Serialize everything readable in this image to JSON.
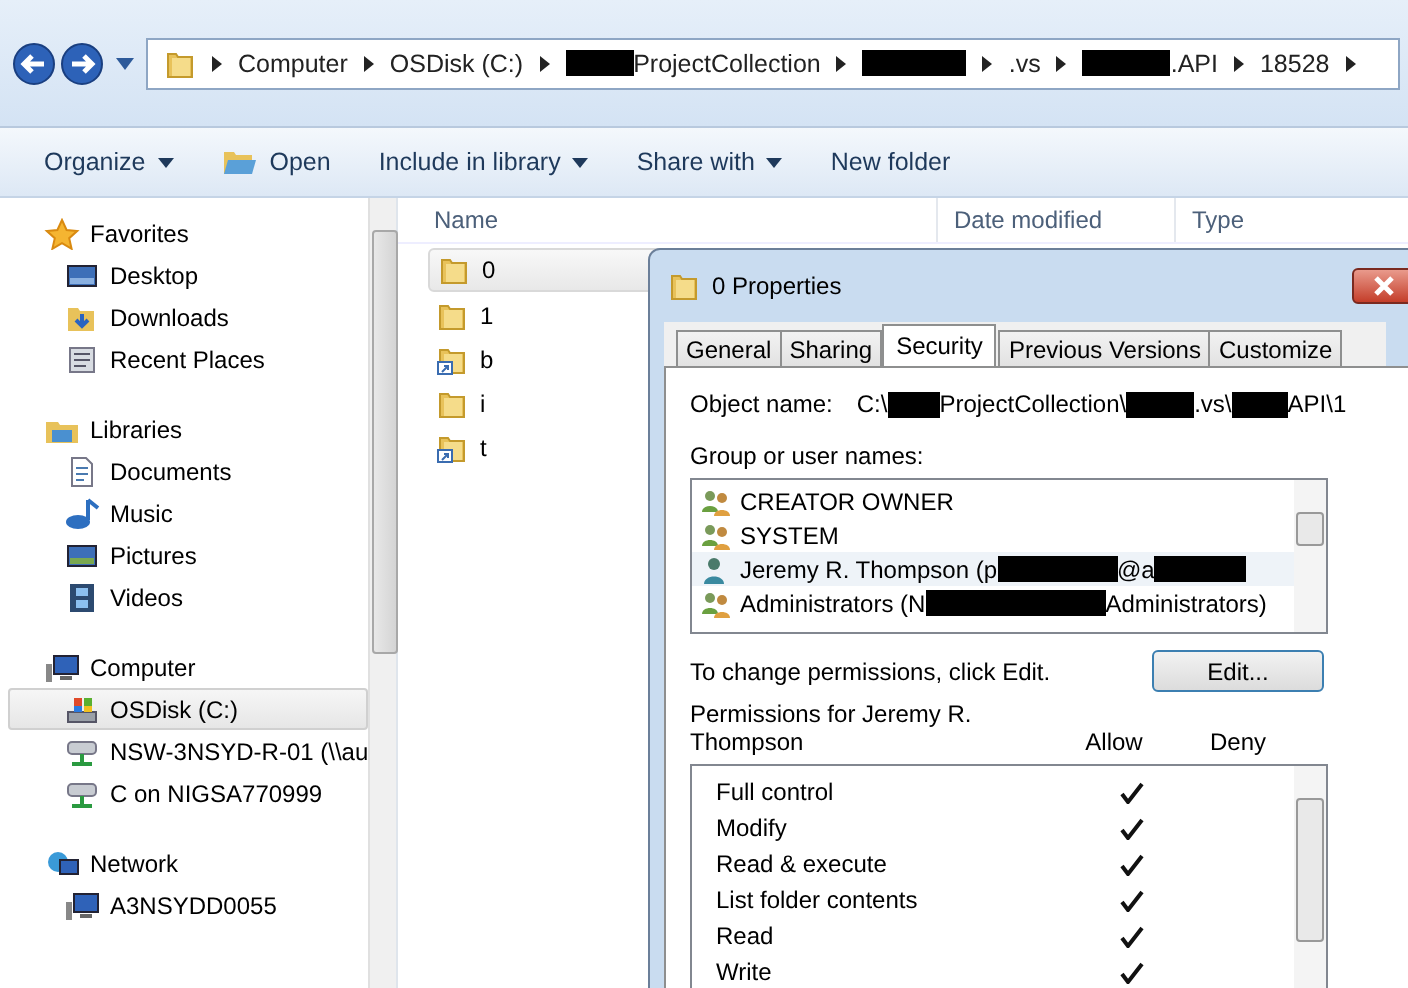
{
  "address_bar": {
    "crumbs": [
      {
        "parts": [
          {
            "text": "Computer"
          }
        ]
      },
      {
        "parts": [
          {
            "text": "OSDisk (C:)"
          }
        ]
      },
      {
        "parts": [
          {
            "kind": "redaction"
          },
          {
            "text": "ProjectCollection"
          }
        ]
      },
      {
        "parts": [
          {
            "kind": "redaction"
          }
        ]
      },
      {
        "parts": [
          {
            "text": ".vs"
          }
        ]
      },
      {
        "parts": [
          {
            "kind": "redaction"
          },
          {
            "text": ".API"
          }
        ]
      },
      {
        "parts": [
          {
            "text": "18528"
          }
        ]
      }
    ]
  },
  "toolbar": [
    {
      "label": "Organize",
      "dropdown": true,
      "kind": "plain"
    },
    {
      "label": "Open",
      "dropdown": false,
      "kind": "open"
    },
    {
      "label": "Include in library",
      "dropdown": true,
      "kind": "plain"
    },
    {
      "label": "Share with",
      "dropdown": true,
      "kind": "plain"
    },
    {
      "label": "New folder",
      "dropdown": false,
      "kind": "plain"
    }
  ],
  "sidebar": {
    "groups": [
      {
        "label": "Favorites",
        "items": [
          {
            "label": "Desktop",
            "selected": false
          },
          {
            "label": "Downloads",
            "selected": false
          },
          {
            "label": "Recent Places",
            "selected": false
          }
        ]
      },
      {
        "label": "Libraries",
        "items": [
          {
            "label": "Documents",
            "selected": false
          },
          {
            "label": "Music",
            "selected": false
          },
          {
            "label": "Pictures",
            "selected": false
          },
          {
            "label": "Videos",
            "selected": false
          }
        ]
      },
      {
        "label": "Computer",
        "items": [
          {
            "label": "OSDisk (C:)",
            "selected": true
          },
          {
            "label": "NSW-3NSYD-R-01 (\\\\au",
            "selected": false
          },
          {
            "label": "C on NIGSA770999",
            "selected": false
          }
        ]
      },
      {
        "label": "Network",
        "items": [
          {
            "label": "A3NSYDD0055",
            "selected": false
          }
        ]
      }
    ]
  },
  "file_list": {
    "columns": [
      "Name",
      "Date modified",
      "Type"
    ],
    "rows": [
      {
        "name": "0",
        "kind": "folder",
        "selected": true
      },
      {
        "name": "1",
        "kind": "folder",
        "selected": false
      },
      {
        "name": "b",
        "kind": "shortcut",
        "selected": false
      },
      {
        "name": "i",
        "kind": "folder",
        "selected": false
      },
      {
        "name": "t",
        "kind": "shortcut",
        "selected": false
      }
    ]
  },
  "dialog": {
    "title": "0 Properties",
    "tabs": [
      {
        "label": "General",
        "selected": false
      },
      {
        "label": "Sharing",
        "selected": false
      },
      {
        "label": "Security",
        "selected": true
      },
      {
        "label": "Previous Versions",
        "selected": false
      },
      {
        "label": "Customize",
        "selected": false
      }
    ],
    "object_name_label": "Object name:",
    "object_name": [
      {
        "text": "C:\\"
      },
      {
        "kind": "redaction"
      },
      {
        "text": "ProjectCollection\\"
      },
      {
        "kind": "redaction"
      },
      {
        "text": ".vs\\"
      },
      {
        "kind": "redaction"
      },
      {
        "text": "API\\1"
      }
    ],
    "group_label": "Group or user names:",
    "users": [
      {
        "kind": "group",
        "parts": [
          {
            "text": "CREATOR OWNER"
          }
        ],
        "selected": false
      },
      {
        "kind": "group",
        "parts": [
          {
            "text": "SYSTEM"
          }
        ],
        "selected": false
      },
      {
        "kind": "user",
        "parts": [
          {
            "text": "Jeremy R. Thompson (p"
          },
          {
            "kind": "redaction"
          },
          {
            "text": "@a"
          },
          {
            "kind": "redaction"
          }
        ],
        "selected": true
      },
      {
        "kind": "group",
        "parts": [
          {
            "text": "Administrators (N"
          },
          {
            "kind": "redaction"
          },
          {
            "text": "Administrators)"
          }
        ],
        "selected": false
      }
    ],
    "change_hint": "To change permissions, click Edit.",
    "edit_button": "Edit...",
    "permissions_label": "Permissions for Jeremy R. Thompson",
    "allow_header": "Allow",
    "deny_header": "Deny",
    "permissions": [
      {
        "name": "Full control",
        "allow": true,
        "deny": false
      },
      {
        "name": "Modify",
        "allow": true,
        "deny": false
      },
      {
        "name": "Read & execute",
        "allow": true,
        "deny": false
      },
      {
        "name": "List folder contents",
        "allow": true,
        "deny": false
      },
      {
        "name": "Read",
        "allow": true,
        "deny": false
      },
      {
        "name": "Write",
        "allow": true,
        "deny": false
      }
    ]
  }
}
